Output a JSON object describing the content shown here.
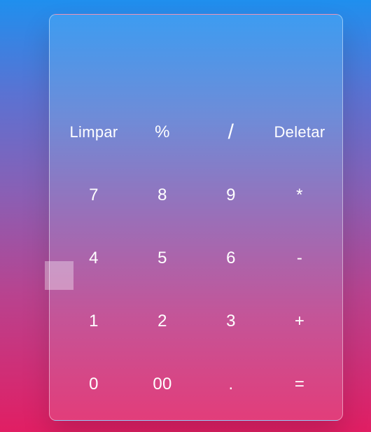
{
  "calculator": {
    "display_value": "",
    "keys": [
      "Limpar",
      "%",
      "/",
      "Deletar",
      "7",
      "8",
      "9",
      "*",
      "4",
      "5",
      "6",
      "-",
      "1",
      "2",
      "3",
      "+",
      "0",
      "00",
      ".",
      "="
    ]
  }
}
